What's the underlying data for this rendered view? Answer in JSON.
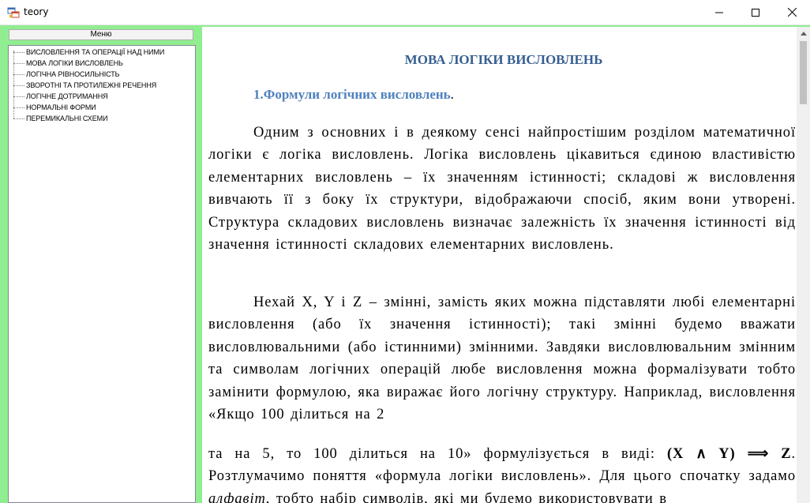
{
  "window": {
    "title": "teory",
    "icon": "app-window-icon",
    "controls": [
      "minimize-icon",
      "maximize-icon",
      "close-icon"
    ]
  },
  "sidebar": {
    "menu_label": "Меню",
    "items": [
      {
        "label": "ВИСЛОВЛЕННЯ ТА ОПЕРАЦІЇ НАД НИМИ"
      },
      {
        "label": "МОВА ЛОГІКИ ВИСЛОВЛЕНЬ"
      },
      {
        "label": "ЛОГІЧНА РІВНОСИЛЬНІСТЬ"
      },
      {
        "label": "ЗВОРОТНІ ТА ПРОТИЛЕЖНІ РЕЧЕННЯ"
      },
      {
        "label": "ЛОГІЧНЕ ДОТРИМАННЯ"
      },
      {
        "label": "НОРМАЛЬНІ ФОРМИ"
      },
      {
        "label": "ПЕРЕМИКАЛЬНІ СХЕМИ"
      }
    ]
  },
  "document": {
    "title": "МОВА ЛОГІКИ ВИСЛОВЛЕНЬ",
    "subtitle": "1.Формули логічних висловлень",
    "subtitle_end": ".",
    "paragraph1": "Одним з основних і в деякому сенсі найпростішим розділом математичної логіки є логіка висловлень. Логіка висловлень цікавиться єдиною властивістю елементарних висловлень – їх значенням істинності; складові ж висловлення вивчають її з боку їх структури, відображаючи спосіб, яким вони утворені. Структура складових висловлень визначає залежність їх значення істинності від значення істинності складових елементарних висловлень.",
    "paragraph2": "Нехай X, Y і Z – змінні, замість яких можна підставляти любі елементарні висловлення (або їх значення істинності); такі змінні будемо вважати висловлювальними (або істинними) змінними. Завдяки висловлювальним змінним та символам логічних операцій любе висловлення можна формалізувати тобто замінити формулою, яка виражає його логічну структуру. Наприклад, висловлення «Якщо 100 ділиться на 2",
    "paragraph3_a": "та на 5, то 100 ділиться на 10» формулізується в виді: ",
    "formula": "(X ∧ Y) ⟹ Z",
    "paragraph3_b": ". Розтлумачимо поняття «формула логіки висловлень». Для цього спочатку задамо ",
    "alphabet_word": "алфавіт",
    "paragraph3_c": ", тобто набір символів, які ми будемо використовувати в"
  },
  "colors": {
    "frame": "#90ee90",
    "title": "#365f91",
    "subtitle": "#4f81bd"
  }
}
